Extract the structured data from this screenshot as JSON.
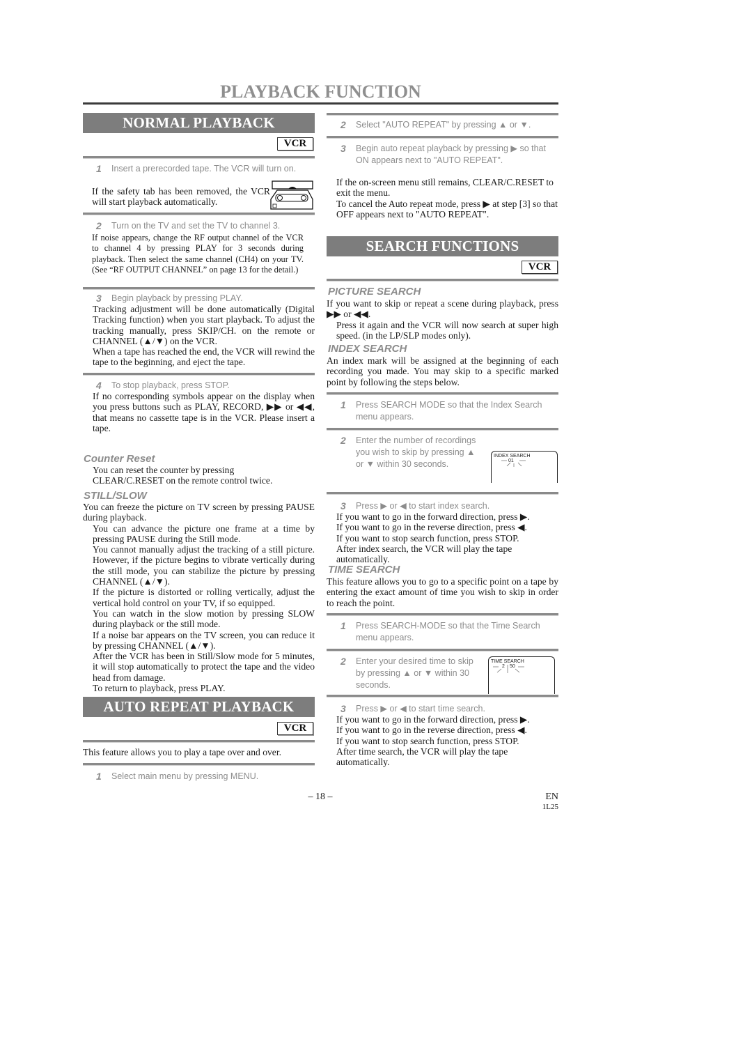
{
  "page": {
    "title": "PLAYBACK FUNCTION",
    "page_number": "– 18 –",
    "language": "EN",
    "code": "1L25"
  },
  "normal_playback": {
    "heading": "NORMAL PLAYBACK",
    "badge": "VCR",
    "steps": [
      {
        "num": "1",
        "text": "Insert a prerecorded tape. The VCR will turn on.",
        "body": [
          "If the safety tab has been removed, the VCR will start playback automatically."
        ],
        "icon": "cassette-tape-icon"
      },
      {
        "num": "2",
        "text": "Turn on the TV and set the TV to channel 3.",
        "body": [
          "If noise appears, change the RF output channel of the VCR to channel 4 by pressing PLAY for 3 seconds during playback.  Then select the same channel (CH4) on your TV. (See “RF OUTPUT CHANNEL” on page 13 for the detail.)"
        ]
      },
      {
        "num": "3",
        "text": "Begin playback by pressing PLAY.",
        "body": [
          "Tracking adjustment will be done automatically (Digital Tracking function) when you start playback. To adjust the tracking manually, press SKIP/CH. on the remote or CHANNEL (▲/▼) on the VCR.",
          "When a tape has reached the end, the VCR will rewind the tape to the beginning, and eject the tape."
        ]
      },
      {
        "num": "4",
        "text": "To stop playback, press STOP.",
        "body": [
          "If no corresponding symbols appear on the display when you press buttons such as PLAY, RECORD, ▶▶ or ◀◀, that means no cassette tape is in the VCR.  Please insert a tape."
        ]
      }
    ]
  },
  "counter_reset": {
    "heading": "Counter Reset",
    "body": [
      "You can reset the counter by pressing",
      "CLEAR/C.RESET on the remote control twice."
    ]
  },
  "still_slow": {
    "heading": "STILL/SLOW",
    "lead": "You can freeze the picture on TV screen by pressing PAUSE during playback.",
    "notes": [
      "You can advance the picture one frame at a time by pressing PAUSE during the Still mode.",
      "You cannot manually adjust the tracking of a still picture. However, if the picture begins to vibrate vertically during the still mode, you can stabilize the picture by pressing CHANNEL (▲/▼).",
      "If the picture is distorted or rolling vertically, adjust the vertical hold control on your TV, if so equipped.",
      "You can watch in the slow motion by pressing SLOW during playback or the still mode.",
      "If a noise bar appears on the TV screen, you can reduce it by pressing CHANNEL (▲/▼).",
      "After the VCR has been in Still/Slow mode for 5 minutes, it will stop automatically to protect the tape and the video head from damage.",
      "To return to playback, press PLAY."
    ]
  },
  "auto_repeat": {
    "heading": "AUTO REPEAT PLAYBACK",
    "badge": "VCR",
    "intro": "This feature allows you to play a tape over and over.",
    "steps": [
      {
        "num": "1",
        "text": "Select main menu by pressing MENU."
      },
      {
        "num": "2",
        "text": "Select \"AUTO REPEAT\" by pressing   ▲ or ▼."
      },
      {
        "num": "3",
        "text": "Begin auto repeat playback by pressing   ▶ so that ON appears next to \"AUTO REPEAT\"."
      }
    ],
    "notes": [
      "If the on-screen menu still remains, CLEAR/C.RESET to exit the menu.",
      "To cancel the Auto repeat mode, press ▶ at step [3] so that OFF appears next to \"AUTO REPEAT\"."
    ]
  },
  "search_functions": {
    "heading": "SEARCH FUNCTIONS",
    "badge": "VCR",
    "picture_search": {
      "heading": "PICTURE SEARCH",
      "lead": "If you want to skip or repeat a scene during playback, press ▶▶ or ◀◀.",
      "note": "Press it again and the VCR will now search at super high speed. (in the LP/SLP modes only)."
    },
    "index_search": {
      "heading": "INDEX SEARCH",
      "lead": "An index mark will be assigned at the beginning of each recording you made. You may skip to a specific marked point by following the steps below.",
      "steps": [
        {
          "num": "1",
          "text": "Press SEARCH MODE so that the Index Search menu appears."
        },
        {
          "num": "2",
          "text": "Enter the number of recordings you wish to skip by pressing   ▲ or ▼ within 30 seconds."
        },
        {
          "num": "3",
          "text": "Press ▶ or ◀ to start index search."
        }
      ],
      "osd": {
        "label": "INDEX SEARCH",
        "value": "01"
      },
      "notes": [
        "If you want to go in the forward direction, press ▶.",
        "If you want to go in the reverse direction, press ◀.",
        "If you want to stop search function, press STOP.",
        "After index search, the VCR will play the tape automatically."
      ]
    },
    "time_search": {
      "heading": "TIME SEARCH",
      "lead": "This feature allows you to go to a specific point on a tape by entering the exact amount of time you wish to skip in order to reach the point.",
      "steps": [
        {
          "num": "1",
          "text": "Press SEARCH-MODE so that the Time Search menu appears."
        },
        {
          "num": "2",
          "text": "Enter your desired time to skip by pressing   ▲ or ▼ within 30 seconds."
        },
        {
          "num": "3",
          "text": "Press ▶ or ◀ to start time search."
        }
      ],
      "osd": {
        "label": "TIME SEARCH",
        "hours": "2",
        "minutes": "50"
      },
      "notes": [
        "If you want to go in the forward direction, press ▶.",
        "If you want to go in the reverse direction, press ◀.",
        "If you want to stop search function, press STOP.",
        "After time search, the VCR will play the tape automatically."
      ]
    }
  }
}
